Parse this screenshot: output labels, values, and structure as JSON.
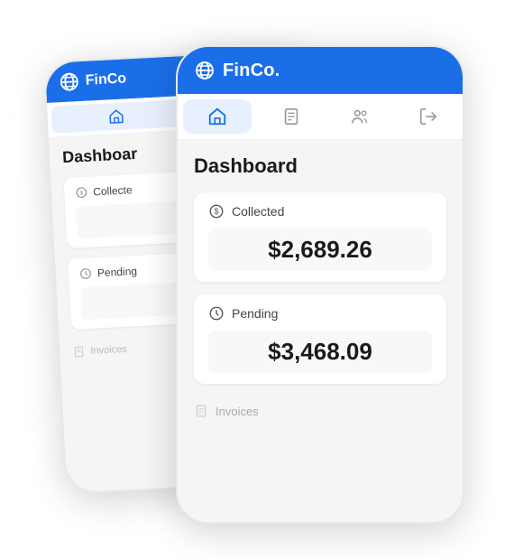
{
  "app": {
    "title": "FinCo.",
    "header_bg": "#1a6fe8"
  },
  "nav": {
    "items": [
      "home",
      "documents",
      "users",
      "logout"
    ],
    "active_index": 0
  },
  "dashboard": {
    "title": "Dashboard",
    "collected_label": "Collected",
    "collected_value": "$2,689.26",
    "pending_label": "Pending",
    "pending_value": "$3,468.09",
    "invoices_label": "Invoices"
  },
  "back_phone": {
    "title": "FinCo",
    "title_truncated": "FinC",
    "page_title": "Dashboar",
    "collected_label": "Collecte",
    "pending_label": "Pending",
    "invoices_label": "Invoices"
  }
}
